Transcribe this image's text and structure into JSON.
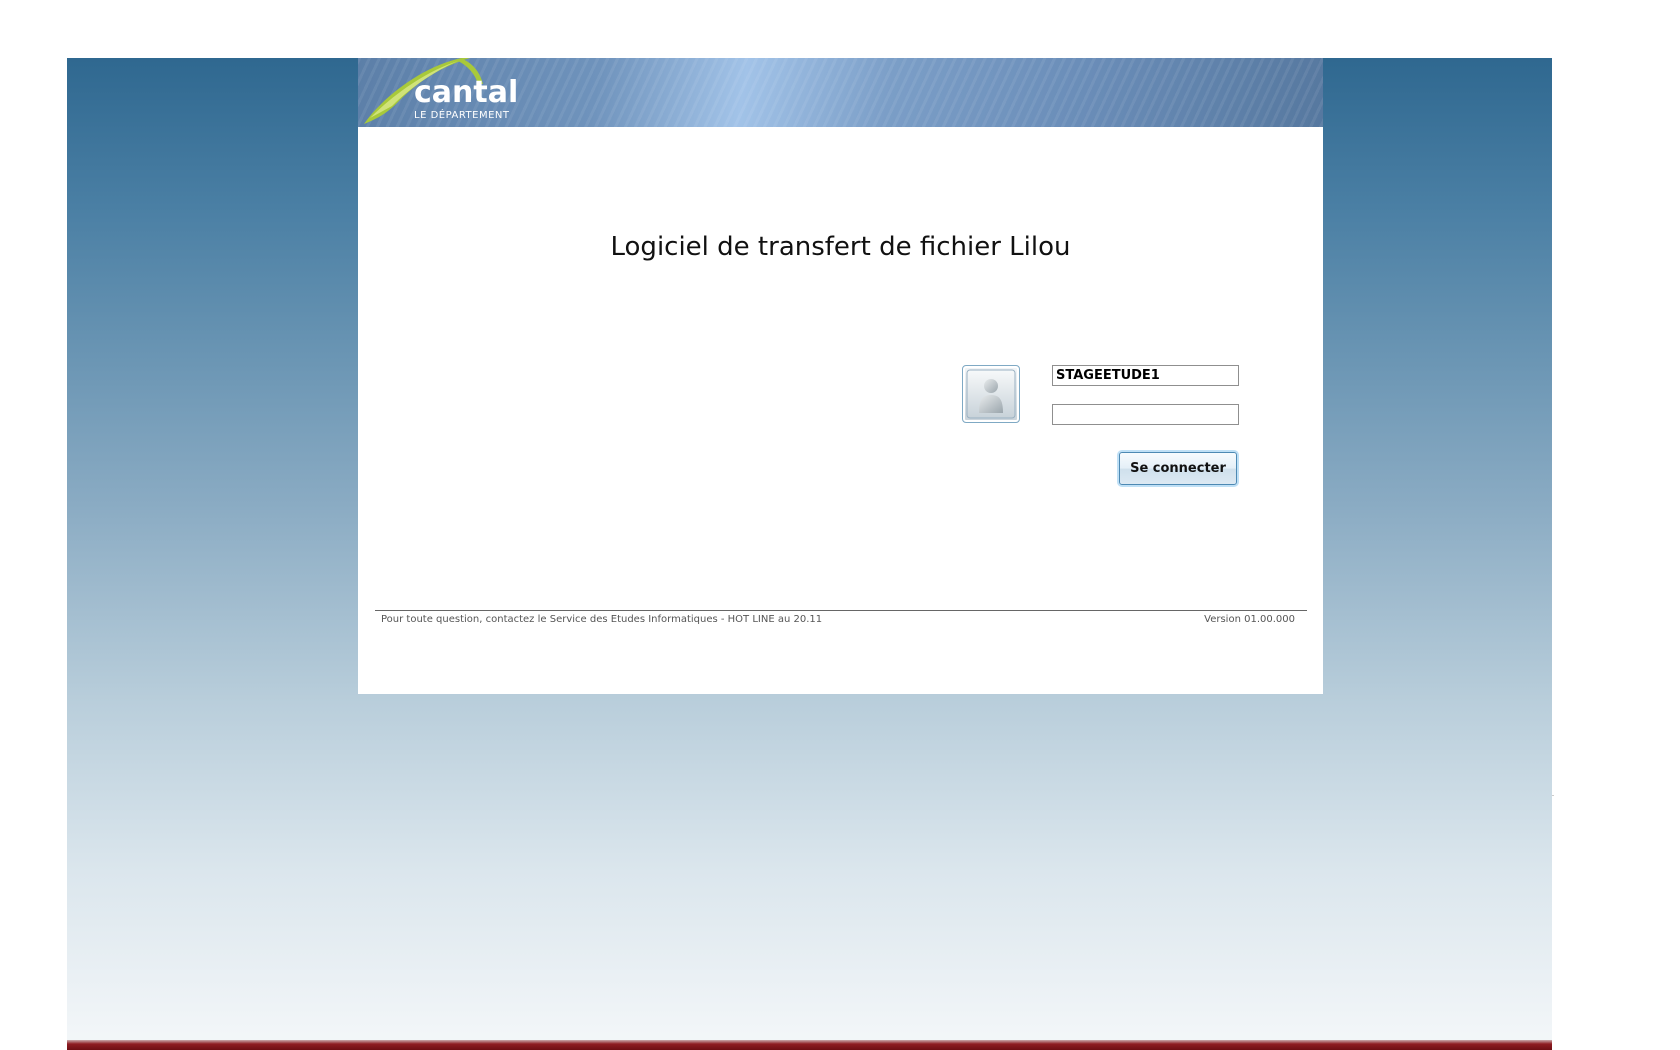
{
  "brand": {
    "name": "cantal",
    "subtitle": "LE DÉPARTEMENT",
    "logo_colors": {
      "arc": "#a8c93a",
      "arc_light": "#d9ea8a",
      "text": "#ffffff"
    }
  },
  "main": {
    "title": "Logiciel de transfert de fichier Lilou"
  },
  "login": {
    "avatar_icon": "user-silhouette-icon",
    "username_value": "STAGEETUDE1",
    "password_value": "",
    "submit_label": "Se connecter"
  },
  "footer": {
    "help_text": "Pour toute question, contactez le Service des Etudes Informatiques - HOT LINE au 20.11",
    "version": "Version 01.00.000"
  },
  "colors": {
    "background_top": "#2f6890",
    "background_bottom": "#f4f7f9",
    "bottom_bar": "#8e1c22",
    "button_focus": "#bfe0f6"
  }
}
